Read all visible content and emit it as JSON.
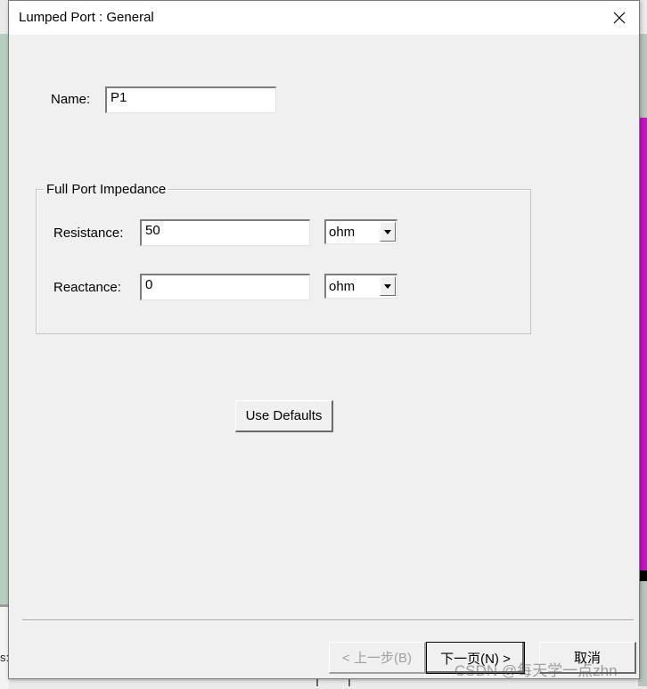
{
  "background": {
    "left_partial_text": "s:",
    "magenta_color": "#c414c4"
  },
  "dialog": {
    "title": "Lumped Port : General",
    "close_icon": "close-icon",
    "name_label": "Name:",
    "name_value": "P1",
    "group_title": "Full Port Impedance",
    "resistance": {
      "label": "Resistance:",
      "value": "50",
      "unit": "ohm"
    },
    "reactance": {
      "label": "Reactance:",
      "value": "0",
      "unit": "ohm"
    },
    "use_defaults_label": "Use Defaults",
    "buttons": {
      "back": "< 上一步(B)",
      "next": "下一页(N) >",
      "cancel": "取消"
    }
  },
  "watermark": "CSDN @每天学一点zhn"
}
